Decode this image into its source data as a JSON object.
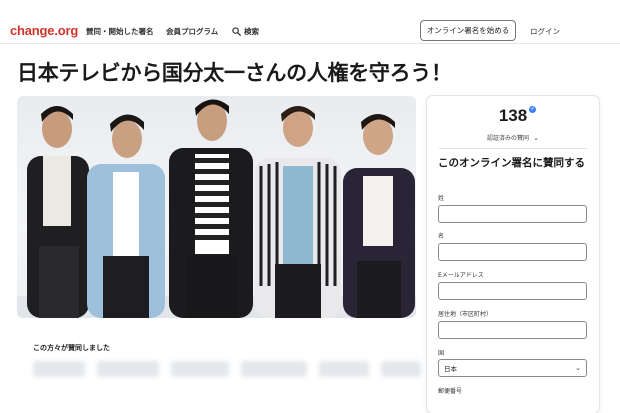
{
  "header": {
    "logo": "change.org",
    "nav": [
      "賛同・開始した署名",
      "会員プログラム",
      "検索"
    ],
    "start_button": "オンライン署名を始める",
    "login": "ログイン"
  },
  "petition": {
    "title": "日本テレビから国分太一さんの人権を守ろう！"
  },
  "supporters": {
    "label": "この方々が賛同しました"
  },
  "sign_card": {
    "count": "138",
    "verified_label": "認証済みの賛同",
    "heading": "このオンライン署名に賛同する",
    "fields": {
      "last_name_label": "姓",
      "first_name_label": "名",
      "email_label": "Eメールアドレス",
      "city_label": "居住地（市区町村）",
      "country_label": "国",
      "country_value": "日本",
      "postal_label": "郵便番号"
    }
  },
  "colors": {
    "brand": "#d0342c",
    "verified": "#3b82f6"
  }
}
